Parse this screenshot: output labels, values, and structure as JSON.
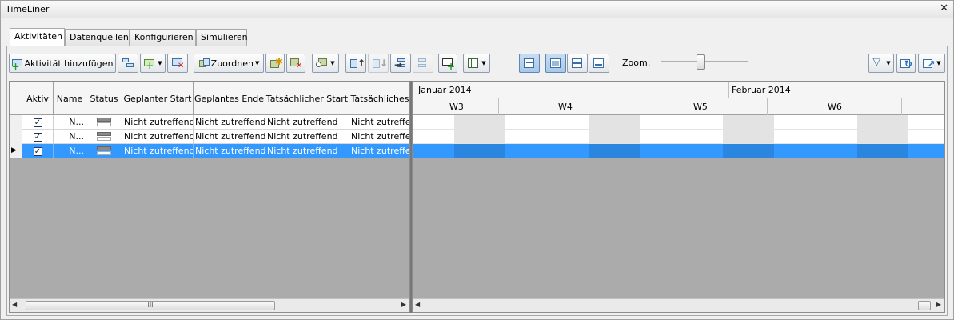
{
  "window": {
    "title": "TimeLiner",
    "close_glyph": "✕"
  },
  "tabs": [
    "Aktivitäten",
    "Datenquellen",
    "Konfigurieren",
    "Simulieren"
  ],
  "toolbar": {
    "add_activity": "Aktivität hinzufügen",
    "assign": "Zuordnen",
    "zoom_label": "Zoom:",
    "zoom_level": 0.45
  },
  "grid": {
    "columns": [
      "Aktiv",
      "Name",
      "Status",
      "Geplanter Start",
      "Geplantes Ende",
      "Tatsächlicher Start",
      "Tatsächliches"
    ],
    "rows": [
      {
        "active": true,
        "name": "N...",
        "planned_start": "Nicht zutreffend",
        "planned_end": "Nicht zutreffend",
        "actual_start": "Nicht zutreffend",
        "actual_end": "Nicht zutreffend",
        "selected": false
      },
      {
        "active": true,
        "name": "N...",
        "planned_start": "Nicht zutreffend",
        "planned_end": "Nicht zutreffend",
        "actual_start": "Nicht zutreffend",
        "actual_end": "Nicht zutreffend",
        "selected": false
      },
      {
        "active": true,
        "name": "N...",
        "planned_start": "Nicht zutreffend",
        "planned_end": "Nicht zutreffend",
        "actual_start": "Nicht zutreffend",
        "actual_end": "Nicht zutreffend",
        "selected": true
      }
    ],
    "scroll_thumb": "III"
  },
  "gantt": {
    "months": [
      "Januar 2014",
      "Februar 2014"
    ],
    "weeks": [
      "W3",
      "W4",
      "W5",
      "W6"
    ]
  },
  "colors": {
    "selection": "#3399ff",
    "weekend": "#e3e3e3",
    "empty": "#ababab"
  }
}
